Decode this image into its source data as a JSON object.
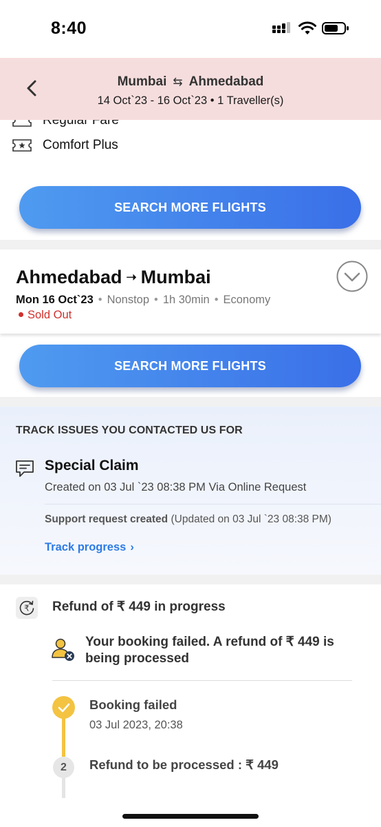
{
  "status_bar": {
    "time": "8:40"
  },
  "header": {
    "origin": "Mumbai",
    "destination": "Ahmedabad",
    "dates": "14 Oct`23 - 16 Oct`23",
    "travellers": "1 Traveller(s)"
  },
  "fare_options": [
    {
      "label": "Regular Fare"
    },
    {
      "label": "Comfort Plus"
    }
  ],
  "search_more_label": "SEARCH MORE FLIGHTS",
  "return_flight": {
    "origin": "Ahmedabad",
    "destination": "Mumbai",
    "date": "Mon 16 Oct`23",
    "stops": "Nonstop",
    "duration": "1h 30min",
    "cabin": "Economy",
    "status": "Sold Out"
  },
  "track_issues": {
    "heading": "TRACK ISSUES YOU CONTACTED US FOR",
    "claim_title": "Special Claim",
    "created": "Created on 03 Jul `23 08:38 PM Via Online Request",
    "support_status": "Support request created",
    "support_updated": "(Updated on 03 Jul `23 08:38 PM)",
    "track_link": "Track progress"
  },
  "refund": {
    "title": "Refund of ₹ 449 in progress",
    "message": "Your booking failed. A refund of ₹ 449 is being processed",
    "steps": [
      {
        "number": "1",
        "title": "Booking failed",
        "date": "03 Jul 2023, 20:38",
        "done": true
      },
      {
        "number": "2",
        "title": "Refund to be processed : ₹ 449",
        "done": false
      }
    ]
  },
  "colors": {
    "header_bg": "#f6dddd",
    "button_gradient_start": "#4f9bf0",
    "button_gradient_end": "#3a6fe8",
    "sold_out": "#d0312d",
    "link": "#2d7be5",
    "timeline_done": "#f3c341"
  }
}
